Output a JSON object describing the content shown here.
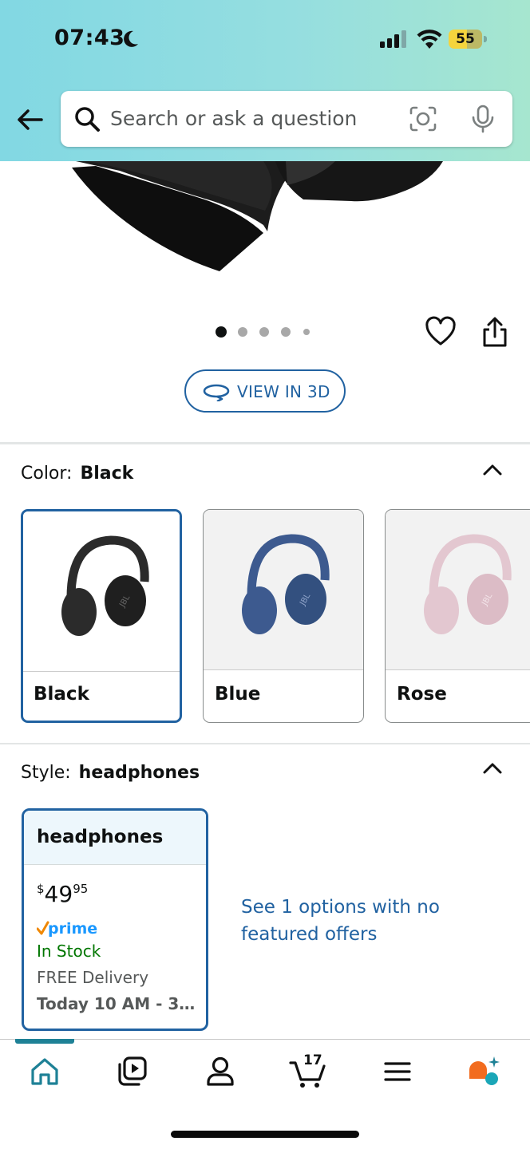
{
  "status_bar": {
    "time": "07:43",
    "battery": "55"
  },
  "search": {
    "placeholder": "Search or ask a question"
  },
  "gallery": {
    "total_images": 5,
    "active_index": 0,
    "view_3d_label": "VIEW IN 3D"
  },
  "color": {
    "label": "Color:",
    "selected": "Black",
    "options": [
      {
        "name": "Black",
        "color": "#2b2b2b"
      },
      {
        "name": "Blue",
        "color": "#3d5a8f"
      },
      {
        "name": "Rose",
        "color": "#e3c7d0"
      }
    ]
  },
  "style": {
    "label": "Style:",
    "selected": "headphones",
    "card": {
      "title": "headphones",
      "price_currency": "$",
      "price_whole": "49",
      "price_cents": "95",
      "prime_label": "prime",
      "stock": "In Stock",
      "delivery": "FREE Delivery",
      "delivery_date": "Today 10 AM - 3…"
    },
    "other_options_link": "See 1 options with no featured offers"
  },
  "nav": {
    "cart_count": "17"
  },
  "colors": {
    "link": "#2162a1",
    "in_stock": "#007600",
    "accent": "#1e8196"
  }
}
